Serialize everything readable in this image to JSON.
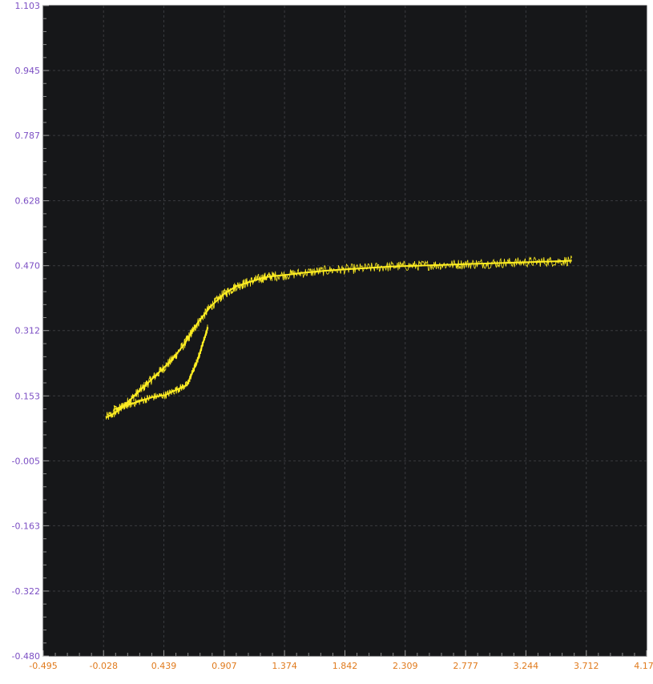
{
  "chart_data": {
    "type": "line",
    "title": "",
    "xlabel": "",
    "ylabel": "",
    "xlim": [
      -0.495,
      4.179
    ],
    "ylim": [
      -0.48,
      1.103
    ],
    "x_ticks": [
      "-0.495",
      "-0.028",
      "0.439",
      "0.907",
      "1.374",
      "1.842",
      "2.309",
      "2.777",
      "3.244",
      "3.712",
      "4.179"
    ],
    "y_ticks": [
      "1.103",
      "0.945",
      "0.787",
      "0.628",
      "0.470",
      "0.312",
      "0.153",
      "-0.005",
      "-0.163",
      "-0.322",
      "-0.480"
    ],
    "grid": true,
    "legend": "none",
    "series": [
      {
        "color": "#ffee22",
        "style": "noisy trace, thick band",
        "band": 0.025,
        "x": [
          -0.01,
          0.05,
          0.1,
          0.15,
          0.2,
          0.25,
          0.3,
          0.35,
          0.4,
          0.45,
          0.5,
          0.55,
          0.6,
          0.63,
          0.66,
          0.7,
          0.75,
          0.8,
          0.85,
          0.9,
          0.95,
          1.0,
          1.05,
          1.1,
          1.15,
          1.2,
          1.25,
          1.3,
          1.4,
          1.5,
          1.6,
          1.7,
          1.8,
          1.9,
          2.0,
          2.1,
          2.2,
          2.3,
          2.4,
          2.5,
          2.6,
          2.7,
          2.8,
          2.9,
          3.0,
          3.1,
          3.2,
          3.3,
          3.4,
          3.5,
          3.6
        ],
        "y": [
          0.1,
          0.11,
          0.12,
          0.135,
          0.15,
          0.165,
          0.18,
          0.195,
          0.21,
          0.225,
          0.24,
          0.26,
          0.28,
          0.295,
          0.31,
          0.33,
          0.35,
          0.37,
          0.385,
          0.4,
          0.41,
          0.42,
          0.425,
          0.43,
          0.435,
          0.44,
          0.443,
          0.445,
          0.448,
          0.452,
          0.455,
          0.458,
          0.46,
          0.462,
          0.464,
          0.466,
          0.468,
          0.469,
          0.47,
          0.471,
          0.472,
          0.473,
          0.474,
          0.475,
          0.476,
          0.477,
          0.478,
          0.479,
          0.48,
          0.481,
          0.482
        ]
      },
      {
        "color": "#ffee22",
        "style": "noisy trace, lower loop",
        "band": 0.02,
        "x": [
          0.05,
          0.15,
          0.25,
          0.35,
          0.45,
          0.55,
          0.62,
          0.66,
          0.7,
          0.74,
          0.78
        ],
        "y": [
          0.12,
          0.13,
          0.14,
          0.15,
          0.155,
          0.17,
          0.18,
          0.21,
          0.24,
          0.28,
          0.32
        ]
      }
    ]
  }
}
